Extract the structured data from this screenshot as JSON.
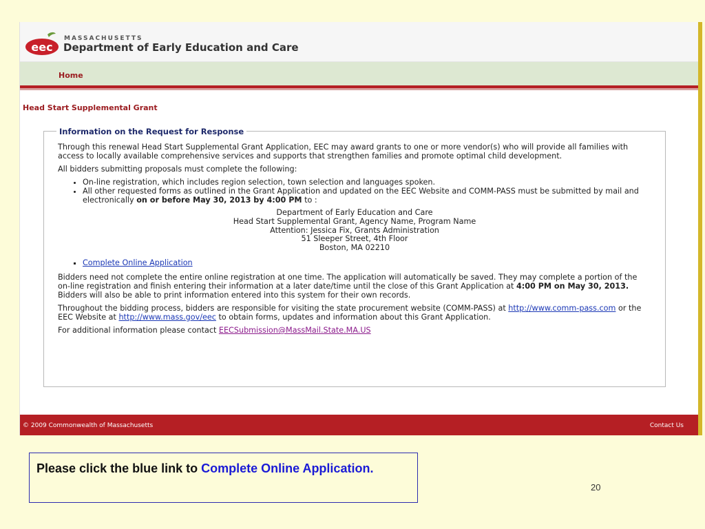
{
  "header": {
    "brand_top": "MASSACHUSETTS",
    "brand_main": "Department of Early Education and Care",
    "logo_text": "eec",
    "nav_home": "Home"
  },
  "page_title": "Head Start Supplemental Grant",
  "panel": {
    "legend": "Information on the Request for Response",
    "intro": "Through this renewal Head Start Supplemental Grant Application, EEC may award grants to one or more vendor(s) who will provide all families with access to locally available comprehensive services and supports that strengthen families and promote optimal child development.",
    "requirements_lead": "All bidders submitting proposals must complete the following:",
    "bullet1": "On-line registration, which includes region selection, town selection and languages spoken.",
    "bullet2_pre": "All other requested forms as outlined in the Grant Application and updated on the EEC Website and COMM-PASS must be submitted by mail and electronically ",
    "bullet2_bold": "on or before May 30, 2013 by 4:00 PM",
    "bullet2_post": " to :",
    "address": [
      "Department of Early Education and Care",
      "Head Start Supplemental Grant, Agency Name, Program Name",
      "Attention: Jessica Fix, Grants Administration",
      "51 Sleeper Street, 4th Floor",
      "Boston, MA 02210"
    ],
    "complete_link": "Complete Online Application",
    "para2_pre": "Bidders need not complete the entire online registration at one time. The application will automatically be saved. They may complete a portion of the on-line registration and finish entering their information at a later date/time until the close of this Grant Application at ",
    "para2_bold": "4:00 PM on May 30, 2013.",
    "para2_post": " Bidders will also be able to print information entered into this system for their own records.",
    "para3_a": "Throughout the bidding process, bidders are responsible for visiting the state procurement website (COMM-PASS) at ",
    "link_commpass": "http://www.comm-pass.com",
    "para3_b": " or the EEC Website at ",
    "link_eec": "http://www.mass.gov/eec",
    "para3_c": " to obtain forms, updates and information about this Grant Application.",
    "para4": "For additional information please contact ",
    "email": "EECSubmission@MassMail.State.MA.US"
  },
  "footer": {
    "copyright": "© 2009 Commonwealth of Massachusetts",
    "contact": "Contact Us"
  },
  "callout": {
    "text_pre": "Please click the blue link to ",
    "text_link": "Complete Online Application."
  },
  "slide_number": "20",
  "colors": {
    "slide_bg": "#fdfcd9",
    "brand_red": "#b51f24",
    "nav_green": "#dde8d2",
    "link_blue": "#1a37b5",
    "callout_blue": "#1a1ad6"
  }
}
